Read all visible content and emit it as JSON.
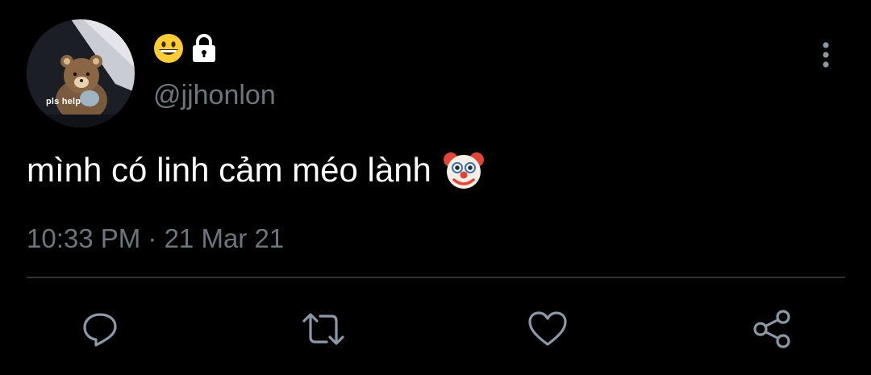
{
  "profile": {
    "avatar_caption": "pls help",
    "name_emoji": "grinning-face-emoji",
    "protected_icon": "lock-icon",
    "handle": "@jjhonlon"
  },
  "tweet": {
    "text": "mình có linh cảm méo lành",
    "trailing_emoji": "clown-face-emoji",
    "timestamp": "10:33 PM · 21 Mar 21"
  },
  "actions": [
    {
      "name": "reply",
      "icon": "reply-icon"
    },
    {
      "name": "retweet",
      "icon": "retweet-icon"
    },
    {
      "name": "like",
      "icon": "heart-icon"
    },
    {
      "name": "share",
      "icon": "share-icon"
    }
  ],
  "colors": {
    "background": "#000000",
    "text": "#ffffff",
    "secondary_text": "#6e767d",
    "icon": "#8b98a5",
    "divider": "#2f3336"
  }
}
